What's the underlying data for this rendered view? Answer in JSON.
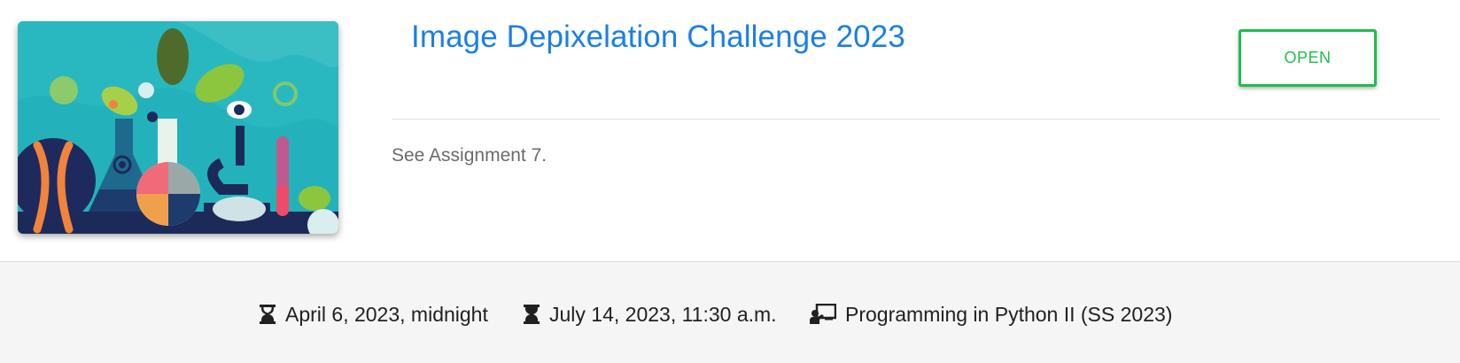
{
  "challenge": {
    "title": "Image Depixelation Challenge 2023",
    "status_label": "OPEN",
    "description": "See Assignment 7.",
    "image_icon": "science-illustration"
  },
  "meta": {
    "start_date": "April 6, 2023, midnight",
    "start_icon": "hourglass-icon",
    "end_date": "July 14, 2023, 11:30 a.m.",
    "end_icon": "hourglass-icon",
    "course": "Programming in Python II (SS 2023)",
    "course_icon": "presenter-icon"
  },
  "colors": {
    "title": "#1a7fe8",
    "status": "#1cc04c",
    "footer_bg": "#f5f5f5"
  }
}
